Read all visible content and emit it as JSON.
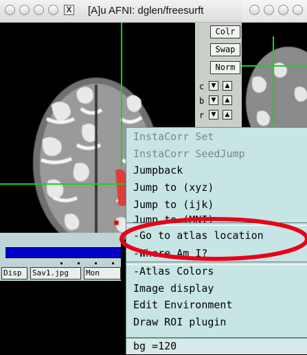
{
  "window": {
    "title": "[A]u AFNI: dglen/freesurft",
    "close_glyph": "X"
  },
  "controls": {
    "colr": "Colr",
    "swap": "Swap",
    "norm": "Norm",
    "rows": [
      {
        "label": "c",
        "down": "▼",
        "up": "▲"
      },
      {
        "label": "b",
        "down": "▼",
        "up": "▲"
      },
      {
        "label": "r",
        "down": "▼",
        "up": "▲"
      }
    ]
  },
  "bottom_panel": {
    "buttons": [
      "Disp",
      "Sav1.jpg",
      "Mon"
    ]
  },
  "menu": {
    "items": [
      {
        "label": "InstaCorr Set",
        "enabled": false
      },
      {
        "label": "InstaCorr SeedJump",
        "enabled": false
      },
      {
        "label": "Jumpback",
        "enabled": true
      },
      {
        "label": "Jump to (xyz)",
        "enabled": true
      },
      {
        "label": "Jump to (ijk)",
        "enabled": true
      },
      {
        "label": "Jump to (MNI)",
        "enabled": true
      },
      {
        "label": "-Go to atlas location",
        "enabled": true
      },
      {
        "label": "-Where Am I?",
        "enabled": true
      },
      {
        "label": "-Atlas Colors",
        "enabled": true
      },
      {
        "label": "Image display",
        "enabled": true
      },
      {
        "label": "Edit Environment",
        "enabled": true
      },
      {
        "label": "Draw ROI plugin",
        "enabled": true
      }
    ],
    "status": "bg =120"
  },
  "colors": {
    "crosshair": "#19d219",
    "highlight": "#e8001a",
    "menu_background": "#c7e5e5",
    "progress_fill": "#0000c8"
  }
}
